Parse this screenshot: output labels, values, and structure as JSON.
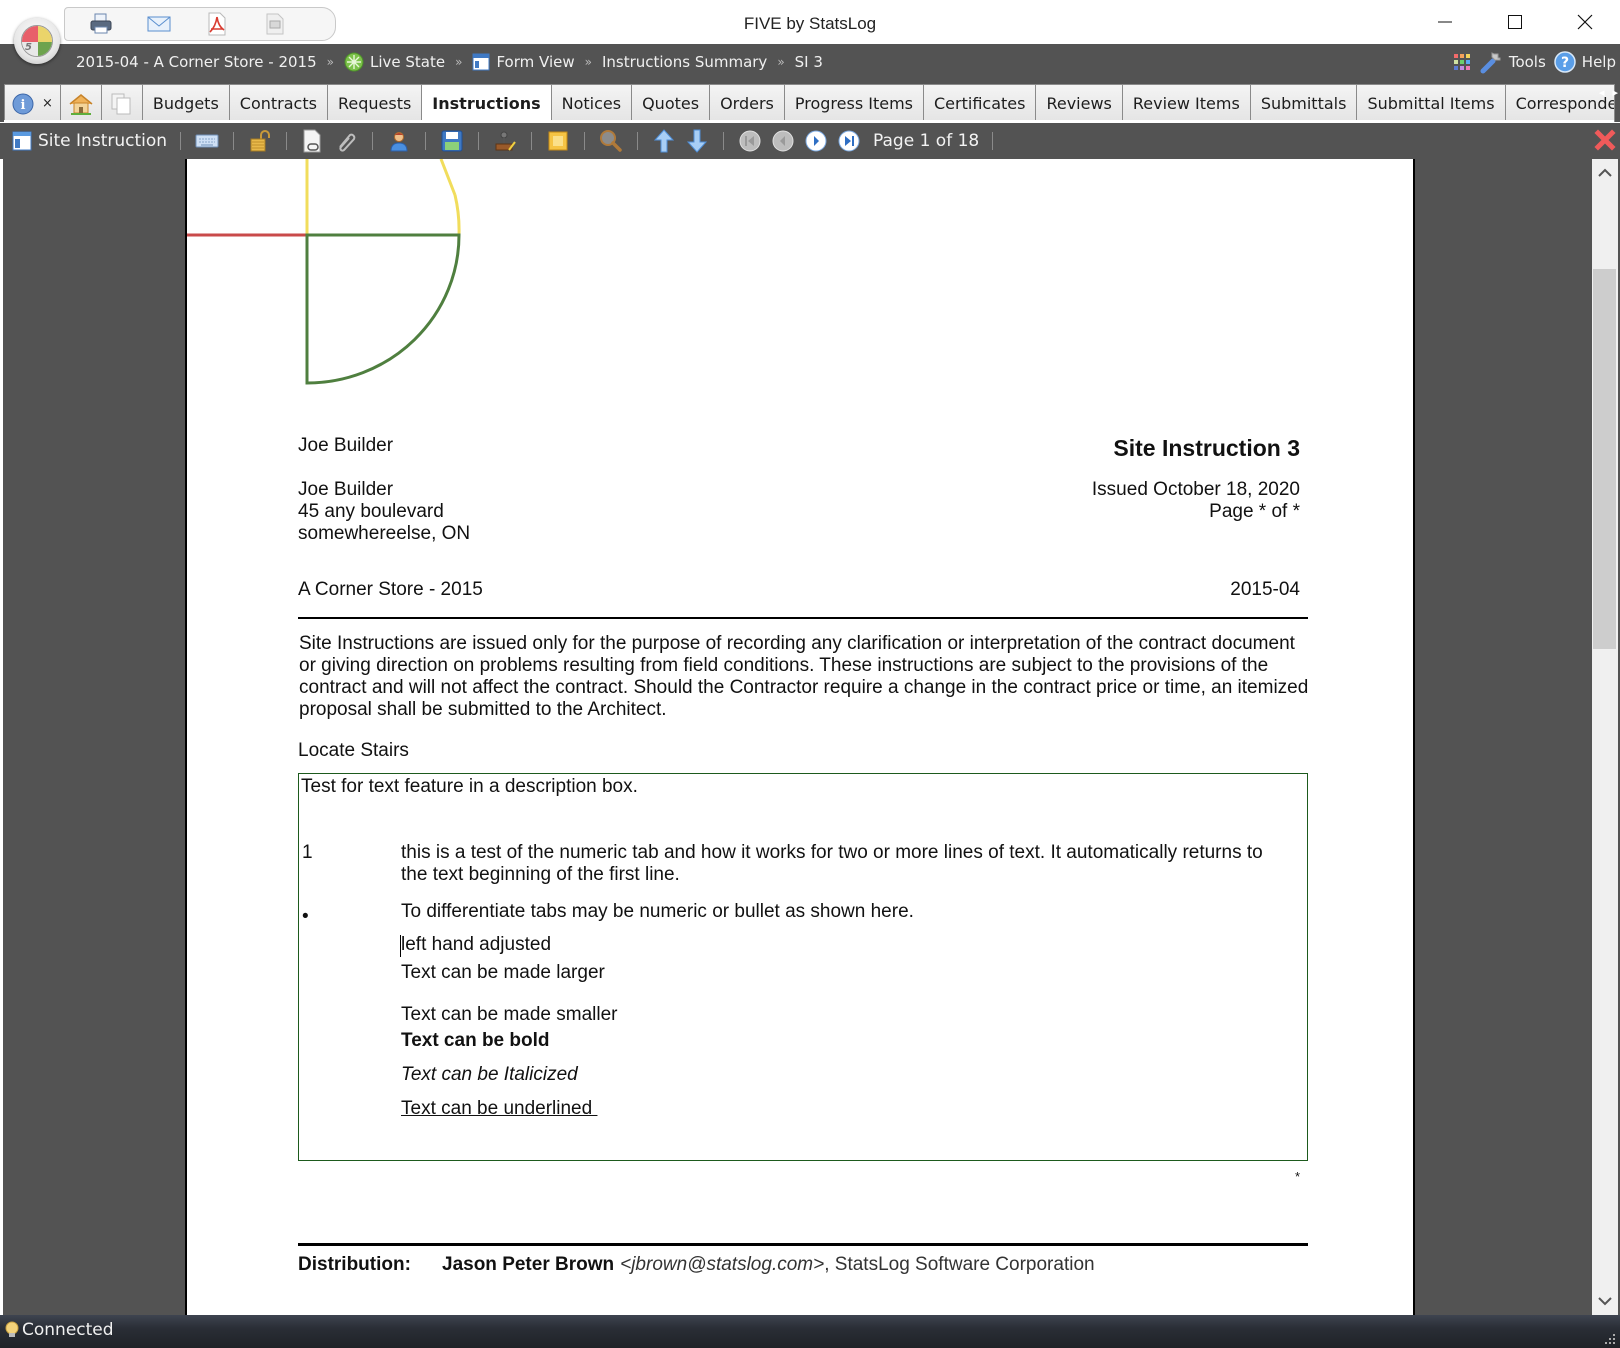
{
  "window": {
    "title": "FIVE by StatsLog",
    "controls": {
      "minimize": "minimize",
      "maximize": "maximize",
      "close": "close"
    }
  },
  "quick_access": [
    {
      "name": "print",
      "icon": "printer-icon"
    },
    {
      "name": "email",
      "icon": "envelope-icon"
    },
    {
      "name": "pdf",
      "icon": "pdf-icon"
    },
    {
      "name": "image",
      "icon": "image-icon"
    }
  ],
  "breadcrumb": {
    "items": [
      {
        "label": "2015-04 - A Corner Store - 2015",
        "icon": null
      },
      {
        "label": "Live State",
        "icon": "live-state-icon"
      },
      {
        "label": "Form View",
        "icon": "form-view-icon"
      },
      {
        "label": "Instructions Summary",
        "icon": null
      },
      {
        "label": "SI 3",
        "icon": null
      }
    ],
    "separator": "»"
  },
  "top_right": {
    "apps_icon": "apps-grid-icon",
    "tools_label": "Tools",
    "help_label": "Help"
  },
  "tabs": {
    "info_close": "×",
    "items": [
      {
        "label": "Budgets",
        "active": false
      },
      {
        "label": "Contracts",
        "active": false
      },
      {
        "label": "Requests",
        "active": false
      },
      {
        "label": "Instructions",
        "active": true
      },
      {
        "label": "Notices",
        "active": false
      },
      {
        "label": "Quotes",
        "active": false
      },
      {
        "label": "Orders",
        "active": false
      },
      {
        "label": "Progress Items",
        "active": false
      },
      {
        "label": "Certificates",
        "active": false
      },
      {
        "label": "Reviews",
        "active": false
      },
      {
        "label": "Review Items",
        "active": false
      },
      {
        "label": "Submittals",
        "active": false
      },
      {
        "label": "Submittal Items",
        "active": false
      },
      {
        "label": "Corresponde",
        "active": false
      }
    ],
    "scroll_left": "◂",
    "scroll_right": "▸"
  },
  "doc_toolbar": {
    "title": "Site Instruction",
    "page_indicator": "Page 1 of 18"
  },
  "document": {
    "from_name": "Joe Builder",
    "address_lines": [
      "Joe Builder",
      "45 any boulevard",
      "somewhereelse, ON"
    ],
    "title": "Site Instruction 3",
    "issued": "Issued October 18, 2020",
    "page_of": "Page * of *",
    "project_name": "A Corner Store - 2015",
    "project_number": "2015-04",
    "disclaimer": "Site Instructions are issued only for the purpose of recording any clarification or interpretation of the contract document or giving direction on problems resulting from field conditions. These instructions are subject to the provisions of the contract and will not affect the contract. Should the Contractor require a change in the contract price or time, an itemized proposal shall be submitted to the Architect.",
    "subject": "Locate Stairs",
    "description": {
      "intro": "Test for text feature in a description box.",
      "numbered_marker": "1",
      "numbered_text": "this is a test of the numeric tab and how it works for two or more lines of text. It automatically returns to the text beginning of the first line.",
      "bullet_marker": "•",
      "bullet_text": "To differentiate tabs may be numeric or bullet as shown here.",
      "left_adjusted": "left hand adjusted",
      "larger": "Text can be made larger",
      "smaller": "Text can be made smaller",
      "bold": "Text can be bold",
      "italic": "Text can be Italicized",
      "underlined": "Text can be underlined "
    },
    "asterisk": "*",
    "distribution": {
      "label": "Distribution:",
      "name": "Jason Peter Brown",
      "email": "<jbrown@statslog.com>",
      "org": ", StatsLog Software Corporation"
    },
    "logo_colors": {
      "red": "#c94a4a",
      "yellow": "#f1dd5c",
      "green": "#4f7f3f"
    }
  },
  "status": {
    "text": "Connected",
    "icon": "lightbulb-icon"
  }
}
